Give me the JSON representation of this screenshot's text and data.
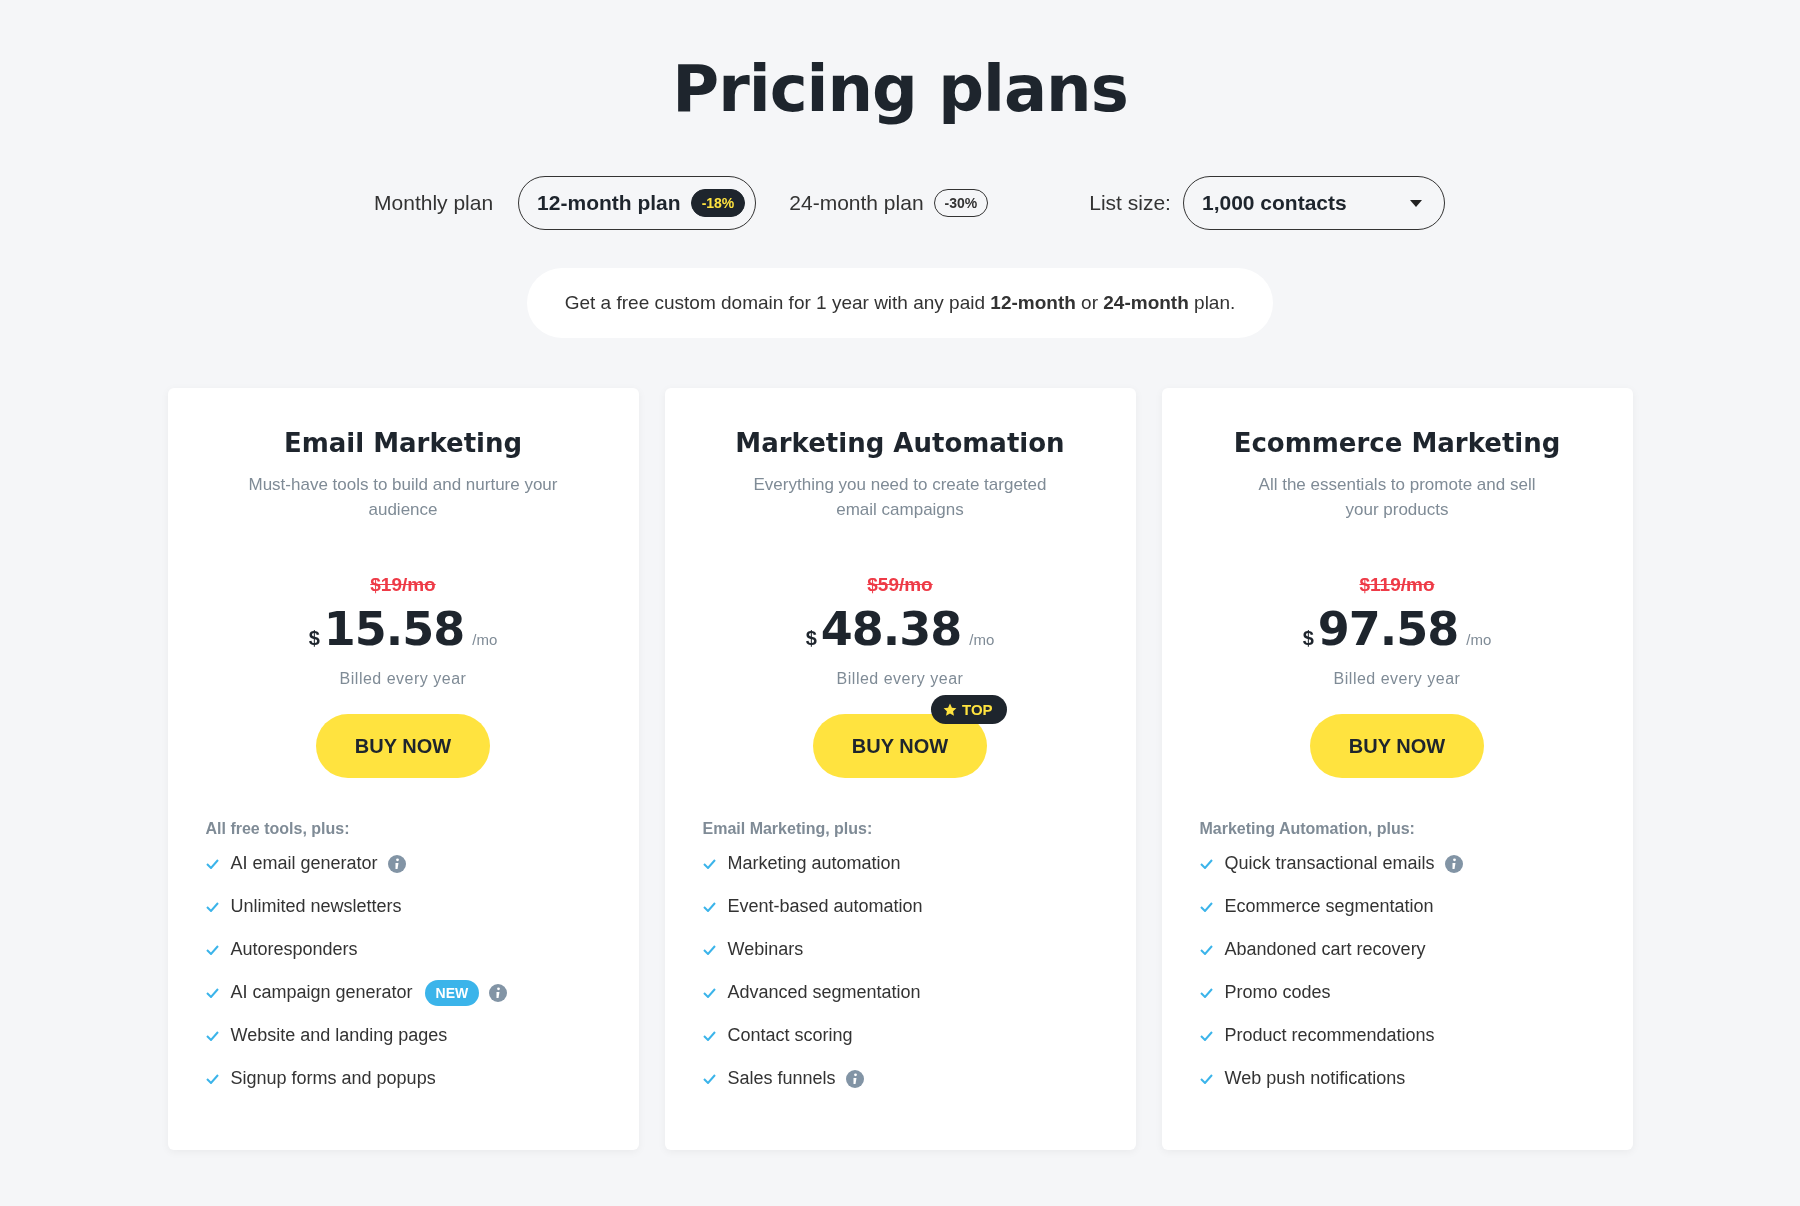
{
  "title": "Pricing plans",
  "billing_tabs": [
    {
      "label": "Monthly plan",
      "selected": false
    },
    {
      "label": "12-month plan",
      "badge": "-18%",
      "selected": true
    },
    {
      "label": "24-month plan",
      "badge": "-30%",
      "selected": false
    }
  ],
  "list_size": {
    "label": "List size:",
    "value": "1,000 contacts"
  },
  "banner": "Get a free custom domain for 1 year with any paid **12-month** or **24-month** plan.",
  "plans": [
    {
      "name": "Email Marketing",
      "description": "Must-have tools to build and nurture your audience",
      "old_price": "$19/mo",
      "currency": "$",
      "price": "15.58",
      "period": "/mo",
      "billing": "Billed every year",
      "button": "BUY NOW",
      "features_heading": "All free tools, plus:",
      "features": [
        {
          "text": "AI email generator",
          "info": true
        },
        {
          "text": "Unlimited newsletters",
          "info": false
        },
        {
          "text": "Autoresponders",
          "info": false
        },
        {
          "text": "AI campaign generator",
          "badge": "NEW",
          "info": true
        },
        {
          "text": "Website and landing pages",
          "info": false
        },
        {
          "text": "Signup forms and popups",
          "info": false
        }
      ]
    },
    {
      "name": "Marketing Automation",
      "description": "Everything you need to create targeted email campaigns",
      "old_price": "$59/mo",
      "currency": "$",
      "price": "48.38",
      "period": "/mo",
      "billing": "Billed every year",
      "button": "BUY NOW",
      "ribbon": "TOP",
      "features_heading": "Email Marketing, plus:",
      "features": [
        {
          "text": "Marketing automation",
          "info": false
        },
        {
          "text": "Event-based automation",
          "info": false
        },
        {
          "text": "Webinars",
          "info": false
        },
        {
          "text": "Advanced segmentation",
          "info": false
        },
        {
          "text": "Contact scoring",
          "info": false
        },
        {
          "text": "Sales funnels",
          "info": true
        }
      ]
    },
    {
      "name": "Ecommerce Marketing",
      "description": "All the essentials to promote and sell your products",
      "old_price": "$119/mo",
      "currency": "$",
      "price": "97.58",
      "period": "/mo",
      "billing": "Billed every year",
      "button": "BUY NOW",
      "features_heading": "Marketing Automation, plus:",
      "features": [
        {
          "text": "Quick transactional emails",
          "info": true
        },
        {
          "text": "Ecommerce segmentation",
          "info": false
        },
        {
          "text": "Abandoned cart recovery",
          "info": false
        },
        {
          "text": "Promo codes",
          "info": false
        },
        {
          "text": "Product recommendations",
          "info": false
        },
        {
          "text": "Web push notifications",
          "info": false
        }
      ]
    }
  ]
}
